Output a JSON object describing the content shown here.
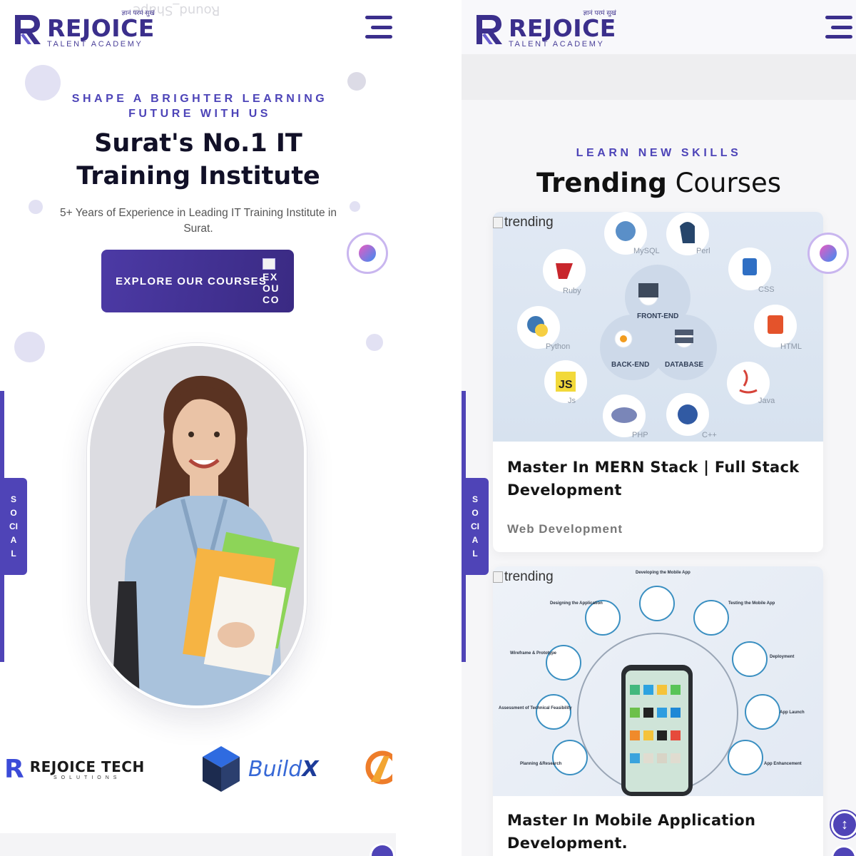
{
  "brand": {
    "name": "REJOICE",
    "sub": "TALENT ACADEMY",
    "tagline": "ज्ञानं परमं सुखं"
  },
  "left": {
    "ghost_text": "Round_Shape",
    "hero": {
      "eyebrow": "SHAPE A BRIGHTER LEARNING FUTURE WITH US",
      "title": "Surat's No.1 IT Training Institute",
      "subtitle": "5+ Years of Experience in Leading IT Training Institute in Surat.",
      "cta_label": "EXPLORE OUR COURSES",
      "cta_alt": "EXOUCO"
    },
    "social_label": "SOCIAL",
    "partners": {
      "rejoice_tech": "REJOICE TECH",
      "rejoice_tech_sub": "SOLUTIONS",
      "buildx_a": "Build",
      "buildx_b": "X"
    }
  },
  "right": {
    "eyebrow": "LEARN NEW SKILLS",
    "title_bold": "Trending",
    "title_rest": "Courses",
    "social_label": "SOCIAL",
    "courses": [
      {
        "img_alt": "trending",
        "title": "Master In MERN Stack | Full Stack Development",
        "category": "Web Development",
        "tech_labels": [
          "MySQL",
          "Perl",
          "CSS",
          "Ruby",
          "FRONT-END",
          "HTML",
          "Python",
          "BACK-END",
          "DATABASE",
          "Js",
          "Java",
          "PHP",
          "C++"
        ]
      },
      {
        "img_alt": "trending",
        "title": "Master In Mobile Application Development.",
        "stage_labels": [
          "Developing the Mobile App",
          "Designing the Application",
          "Testing the Mobile App",
          "Wireframe & Prototype",
          "Deployment",
          "Assessment of Technical Feasibility",
          "App Launch",
          "Planning &Research",
          "App Enhancement"
        ]
      }
    ]
  },
  "colors": {
    "brand_purple": "#3b2f8c",
    "accent": "#4d44b8",
    "cta_start": "#4c3aa5",
    "cta_end": "#3a2a83"
  }
}
